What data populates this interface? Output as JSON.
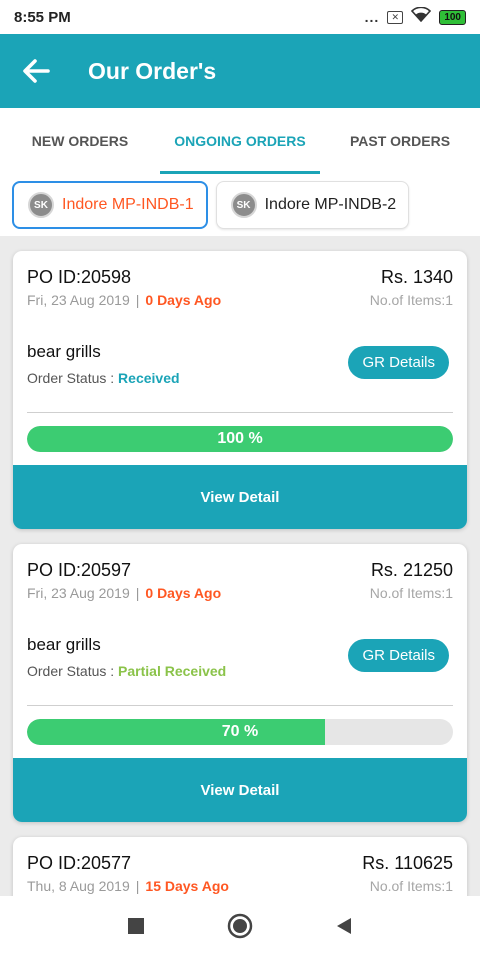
{
  "status_bar": {
    "time": "8:55 PM",
    "dots": "...",
    "battery": "100"
  },
  "app_bar": {
    "title": "Our Order's",
    "back_icon": "arrow-left-icon"
  },
  "tabs": [
    {
      "label": "NEW ORDERS",
      "active": false
    },
    {
      "label": "ONGOING ORDERS",
      "active": true
    },
    {
      "label": "PAST ORDERS",
      "active": false
    }
  ],
  "stores": [
    {
      "avatar": "SK",
      "label": "Indore MP-INDB-1",
      "active": true
    },
    {
      "avatar": "SK",
      "label": "Indore MP-INDB-2",
      "active": false
    }
  ],
  "orders": [
    {
      "po_id": "PO ID:20598",
      "amount": "Rs. 1340",
      "date": "Fri, 23 Aug 2019",
      "ago": "0 Days Ago",
      "items": "No.of Items:1",
      "vendor": "bear grills",
      "status_label": "Order Status :",
      "status": "Received",
      "status_color": "#1ba4b7",
      "gr_label": "GR Details",
      "progress": 100,
      "progress_label": "100 %",
      "view_label": "View Detail"
    },
    {
      "po_id": "PO ID:20597",
      "amount": "Rs. 21250",
      "date": "Fri, 23 Aug 2019",
      "ago": "0 Days Ago",
      "items": "No.of Items:1",
      "vendor": "bear grills",
      "status_label": "Order Status :",
      "status": "Partial Received",
      "status_color": "#8bc34a",
      "gr_label": "GR Details",
      "progress": 70,
      "progress_label": "70 %",
      "view_label": "View Detail"
    },
    {
      "po_id": "PO ID:20577",
      "amount": "Rs. 110625",
      "date": "Thu, 8 Aug 2019",
      "ago": "15 Days Ago",
      "items": "No.of Items:1"
    }
  ],
  "colors": {
    "accent": "#1ba4b7",
    "orange": "#ff5722",
    "progress": "#3ccc72"
  }
}
